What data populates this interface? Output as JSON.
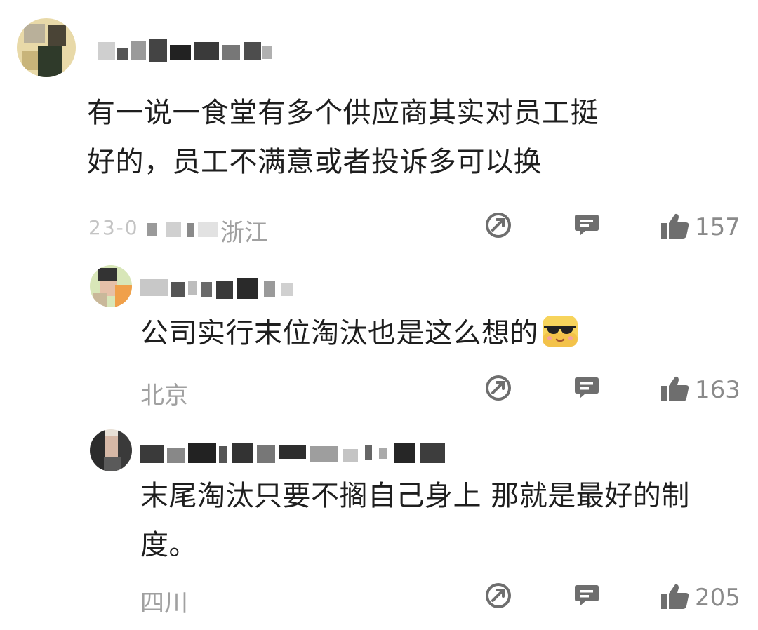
{
  "comments": [
    {
      "text_line1": "有一说一食堂有多个供应商其实对员工挺",
      "text_line2": "好的，员工不满意或者投诉多可以换",
      "location_prefix": "23-0",
      "location": "浙江",
      "likes": "157"
    },
    {
      "text_line1": "公司实行末位淘汰也是这么想的",
      "location": "北京",
      "likes": "163",
      "emoji": "sunglasses-face"
    },
    {
      "text_line1": "末尾淘汰只要不搁自己身上 那就是最好的制",
      "text_line2": "度。",
      "location": "四川",
      "likes": "205"
    }
  ],
  "icons": {
    "share": "share-icon",
    "reply": "reply-icon",
    "like": "thumbs-up-icon"
  },
  "colors": {
    "text": "#1e1e1e",
    "meta": "#a0a0a0",
    "icon": "#6e6e6e"
  }
}
